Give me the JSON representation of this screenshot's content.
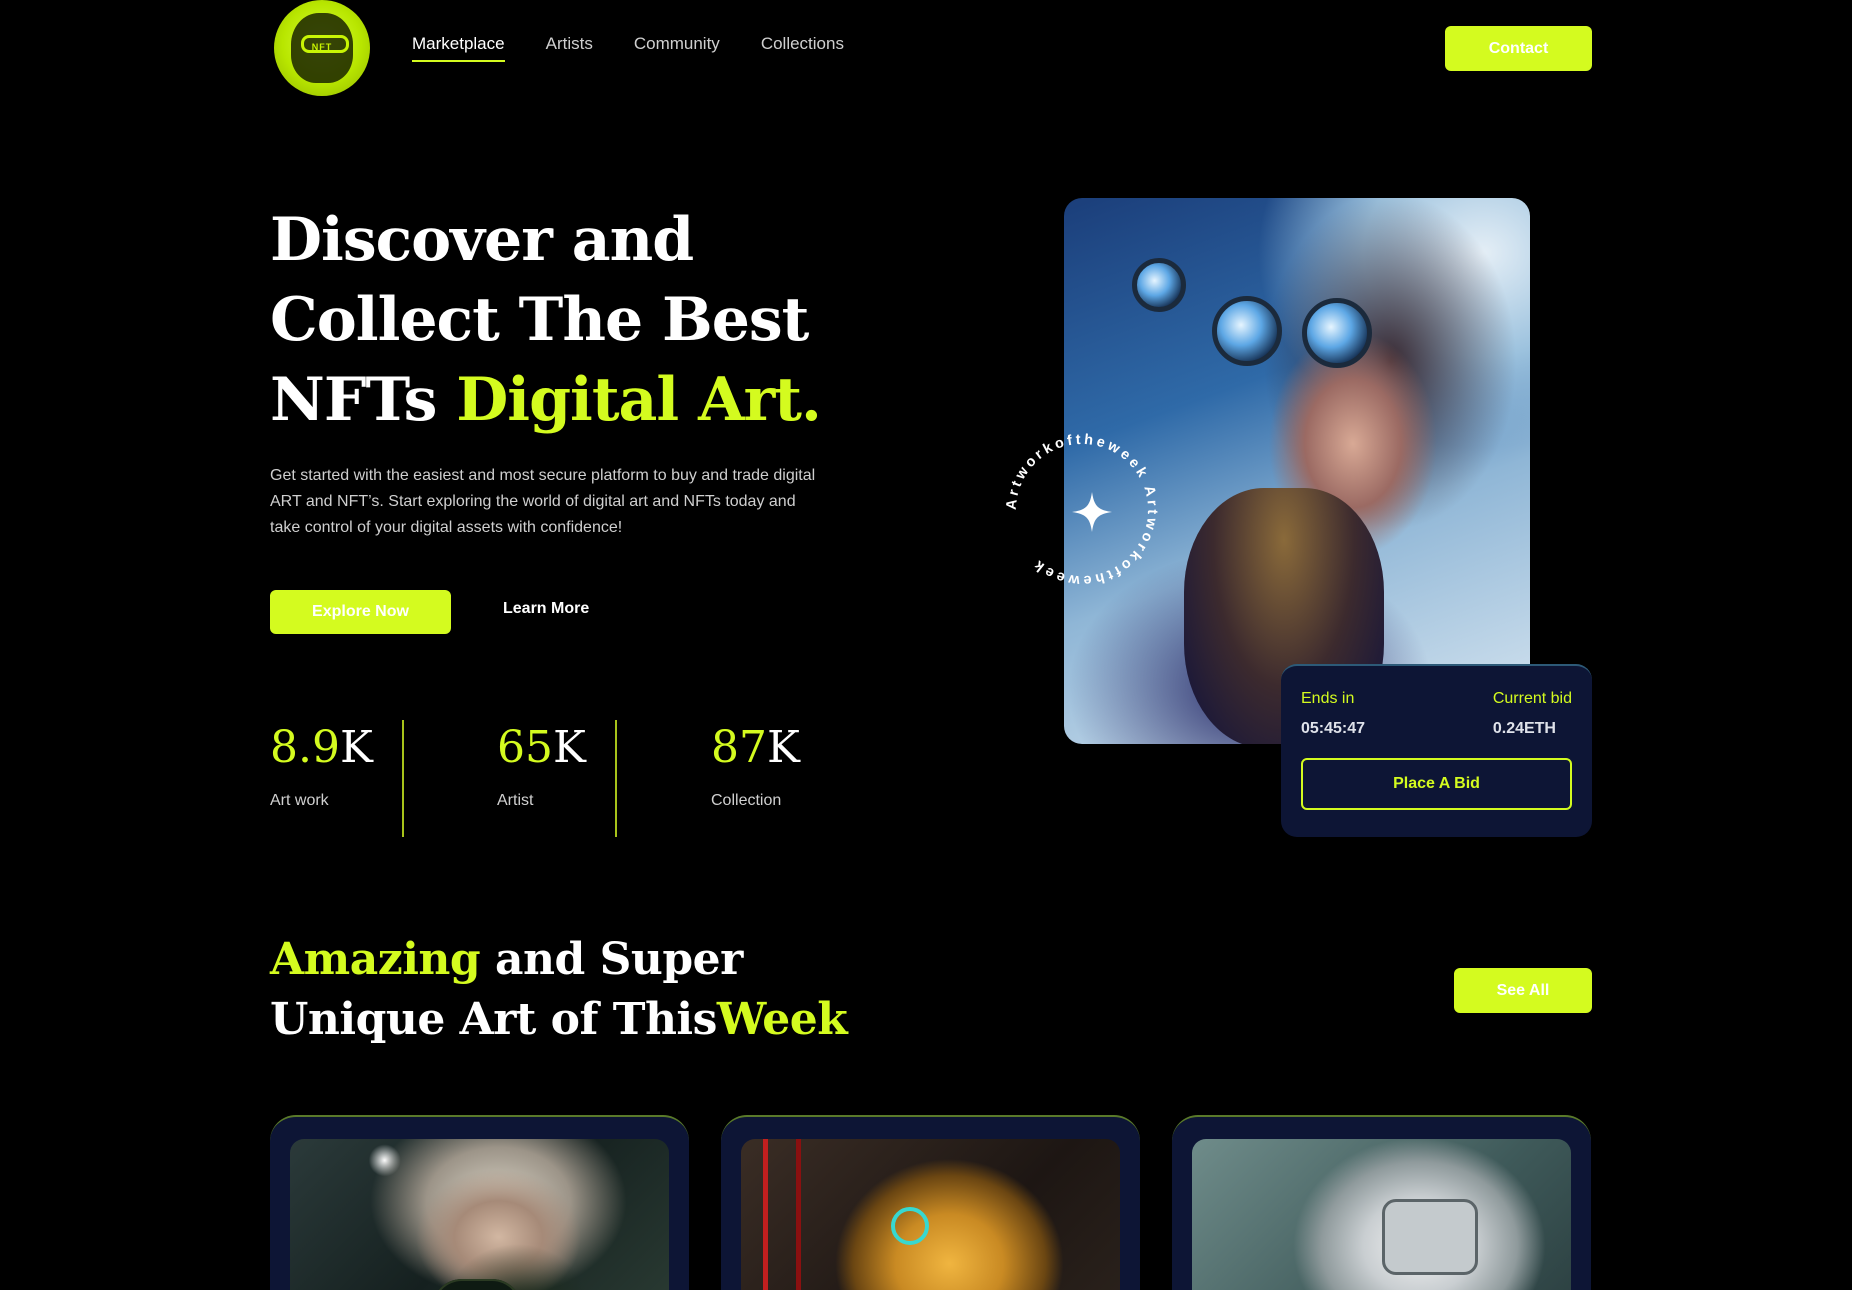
{
  "brand": {
    "logo_text": "NFT"
  },
  "nav": {
    "items": [
      "Marketplace",
      "Artists",
      "Community",
      "Collections"
    ],
    "active": "Marketplace",
    "contact_label": "Contact"
  },
  "hero": {
    "title_line1": "Discover and",
    "title_line2": "Collect The Best",
    "title_line3_plain": "NFTs ",
    "title_line3_accent": "Digital Art.",
    "description": "Get started with the easiest and most secure platform to buy and trade digital ART and NFT’s. Start exploring the world of digital art and NFTs today and take control of your digital assets with confidence!",
    "explore_label": "Explore Now",
    "learn_label": "Learn More"
  },
  "stats": [
    {
      "value": "8.9",
      "suffix": "K",
      "label": "Art work"
    },
    {
      "value": "65",
      "suffix": "K",
      "label": "Artist"
    },
    {
      "value": "87",
      "suffix": "K",
      "label": "Collection"
    }
  ],
  "featured": {
    "ring_text": "Artworkoftheweek Artworkoftheweek ",
    "ends_label": "Ends in",
    "ends_value": "05:45:47",
    "bid_label": "Current bid",
    "bid_value": "0.24ETH",
    "place_bid_label": "Place A Bid"
  },
  "section": {
    "title_accent1": "Amazing",
    "title_plain1": " and Super",
    "title_plain2": "Unique Art of This",
    "title_accent2": "Week",
    "see_all_label": "See All"
  },
  "colors": {
    "accent": "#d4fb1f",
    "background": "#000000",
    "card": "#0d1535"
  }
}
